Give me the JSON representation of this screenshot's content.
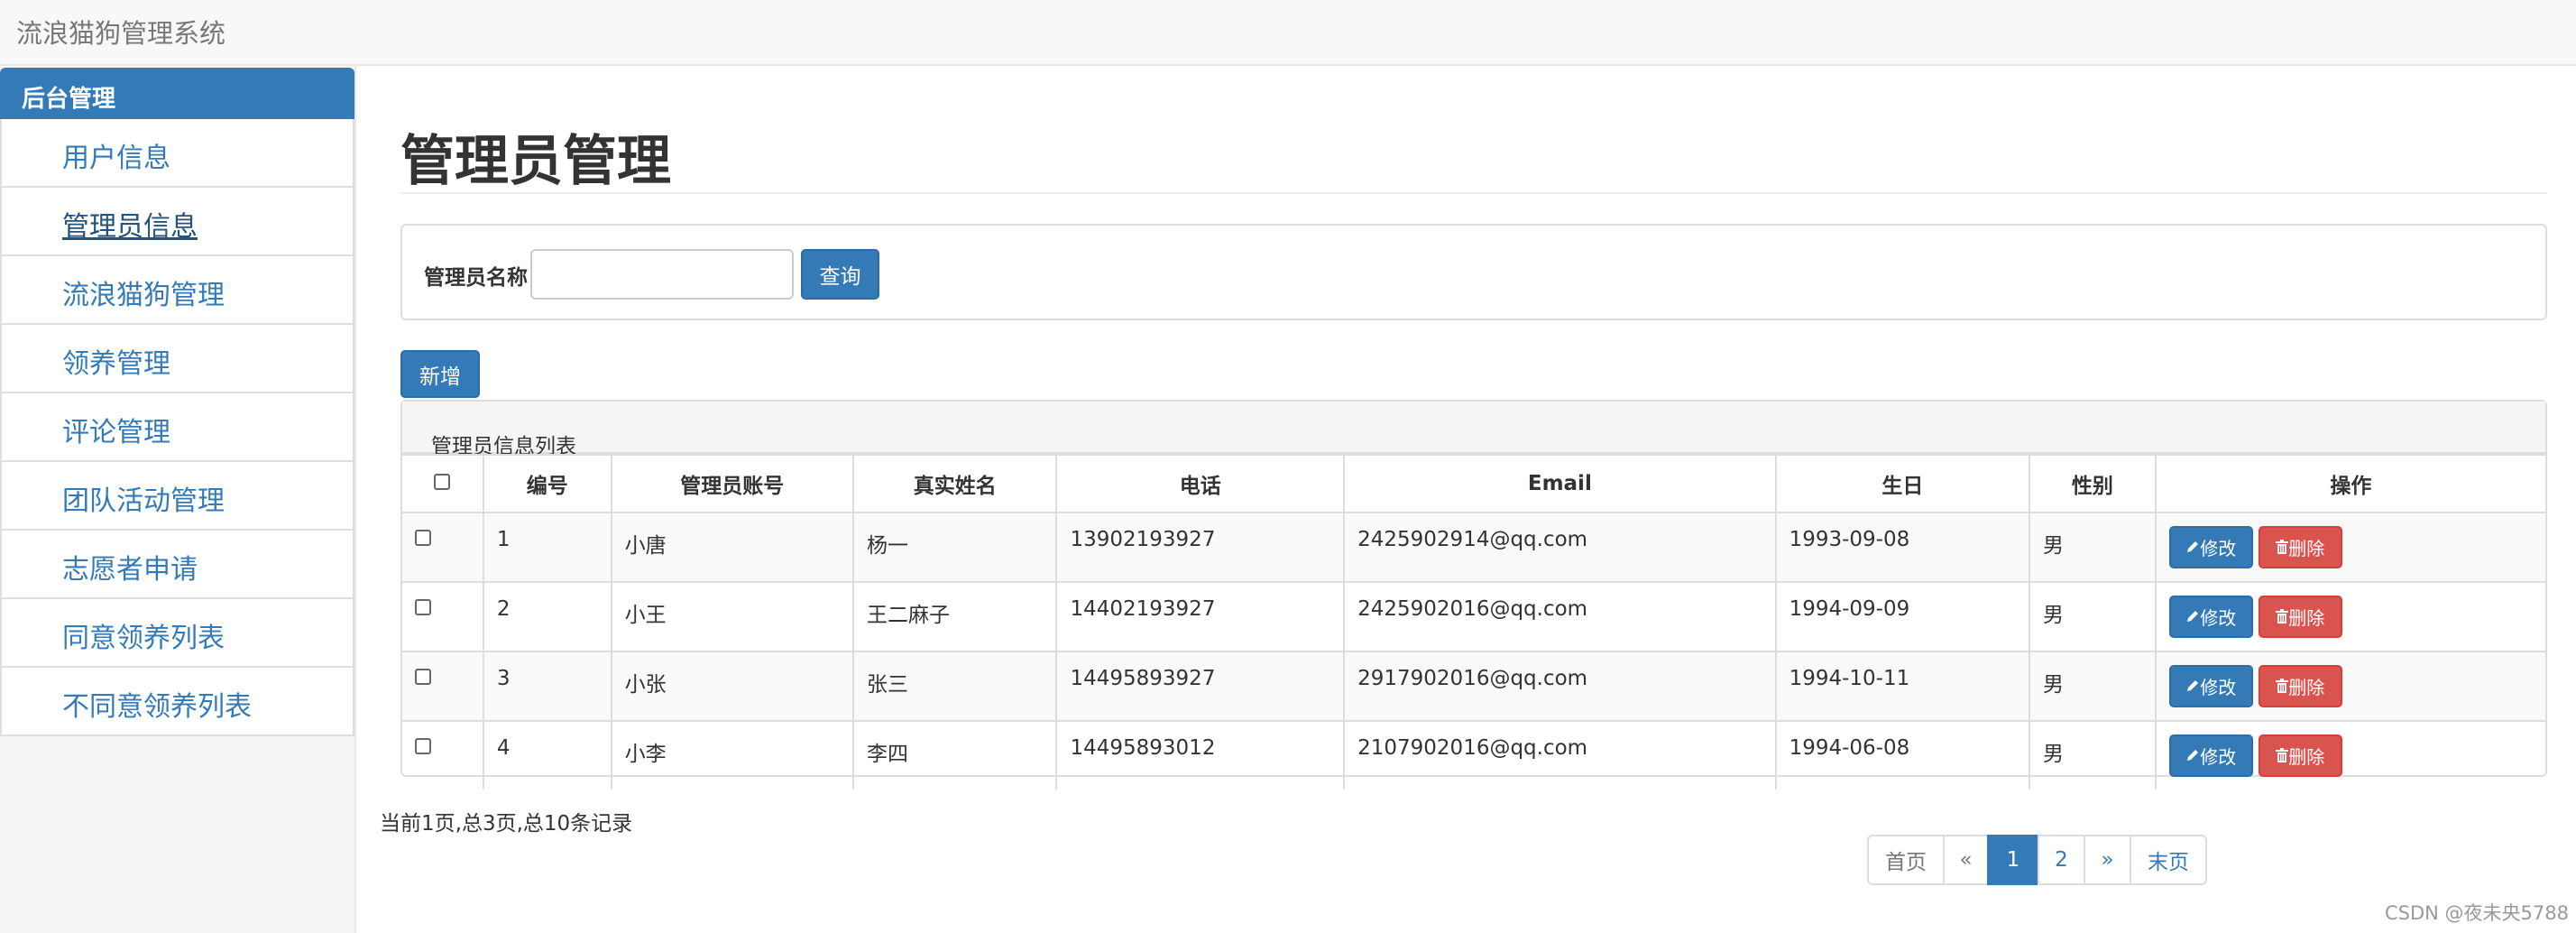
{
  "app_title": "流浪猫狗管理系统",
  "sidebar": {
    "header": "后台管理",
    "items": [
      {
        "label": "用户信息"
      },
      {
        "label": "管理员信息"
      },
      {
        "label": "流浪猫狗管理"
      },
      {
        "label": "领养管理"
      },
      {
        "label": "评论管理"
      },
      {
        "label": "团队活动管理"
      },
      {
        "label": "志愿者申请"
      },
      {
        "label": "同意领养列表"
      },
      {
        "label": "不同意领养列表"
      }
    ],
    "active_index": 1
  },
  "page_title": "管理员管理",
  "search": {
    "label": "管理员名称",
    "value": "",
    "placeholder": "",
    "button": "查询"
  },
  "add_button": "新增",
  "table": {
    "heading": "管理员信息列表",
    "columns": [
      "编号",
      "管理员账号",
      "真实姓名",
      "电话",
      "Email",
      "生日",
      "性别",
      "操作"
    ],
    "rows": [
      {
        "id": "1",
        "account": "小唐",
        "name": "杨一",
        "phone": "13902193927",
        "email": "2425902914@qq.com",
        "birthday": "1993-09-08",
        "gender": "男"
      },
      {
        "id": "2",
        "account": "小王",
        "name": "王二麻子",
        "phone": "14402193927",
        "email": "2425902016@qq.com",
        "birthday": "1994-09-09",
        "gender": "男"
      },
      {
        "id": "3",
        "account": "小张",
        "name": "张三",
        "phone": "14495893927",
        "email": "2917902016@qq.com",
        "birthday": "1994-10-11",
        "gender": "男"
      },
      {
        "id": "4",
        "account": "小李",
        "name": "李四",
        "phone": "14495893012",
        "email": "2107902016@qq.com",
        "birthday": "1994-06-08",
        "gender": "男"
      }
    ],
    "edit_label": "修改",
    "delete_label": "删除"
  },
  "status": "当前1页,总3页,总10条记录",
  "pagination": {
    "first": "首页",
    "prev": "«",
    "pages": [
      "1",
      "2"
    ],
    "current": "1",
    "next": "»",
    "last": "末页"
  },
  "watermark": "CSDN @夜未央5788",
  "colors": {
    "primary": "#337ab7",
    "danger": "#d9534f"
  }
}
